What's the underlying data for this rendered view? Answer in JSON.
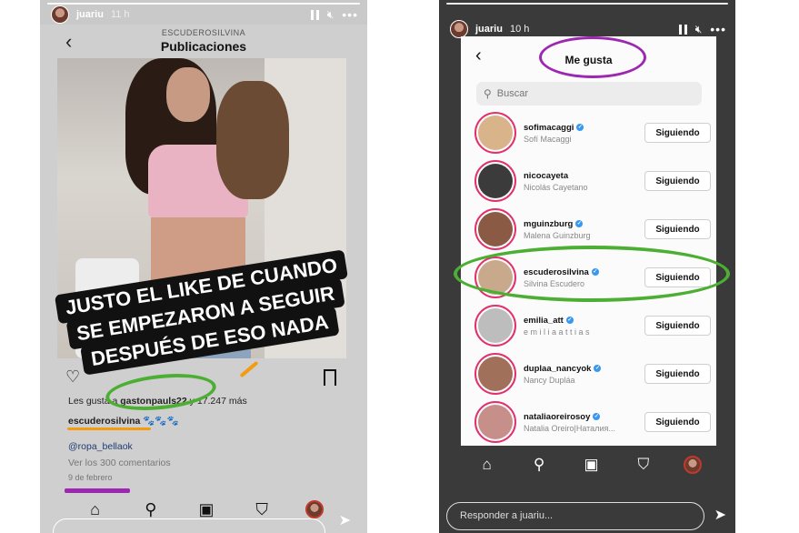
{
  "left_story": {
    "username": "juariu",
    "time": "11 h",
    "post_header_sub": "ESCUDEROSILVINA",
    "post_header_title": "Publicaciones",
    "overlay_lines": [
      "JUSTO EL LIKE DE CUANDO",
      "SE EMPEZARON A SEGUIR",
      "DESPUÉS DE ESO NADA"
    ],
    "likes_prefix": "Les gusta a",
    "likes_user": "gastonpauls22",
    "likes_suffix": "y 17.247 más",
    "caption_user": "escuderosilvina",
    "caption_text": "🐾🐾🐾",
    "mention": "@ropa_bellaok",
    "comments": "Ver los 300 comentarios",
    "date": "9 de febrero"
  },
  "right_story": {
    "username": "juariu",
    "time": "10 h",
    "title": "Me gusta",
    "search_placeholder": "Buscar",
    "users": [
      {
        "handle": "sofimacaggi",
        "name": "Sofí Macaggi",
        "verified": true,
        "button": "Siguiendo",
        "avatar_color": "#d9b48a"
      },
      {
        "handle": "nicocayeta",
        "name": "Nicolás Cayetano",
        "verified": false,
        "button": "Siguiendo",
        "avatar_color": "#3b3b3b"
      },
      {
        "handle": "mguinzburg",
        "name": "Malena Guinzburg",
        "verified": true,
        "button": "Siguiendo",
        "avatar_color": "#8a5a44"
      },
      {
        "handle": "escuderosilvina",
        "name": "Silvina Escudero",
        "verified": true,
        "button": "Siguiendo",
        "avatar_color": "#c9a98c"
      },
      {
        "handle": "emilia_att",
        "name": "e m i l i a   a t t i a s",
        "verified": true,
        "button": "Siguiendo",
        "avatar_color": "#bdbdbd"
      },
      {
        "handle": "duplaa_nancyok",
        "name": "Nancy Dupláa",
        "verified": true,
        "button": "Siguiendo",
        "avatar_color": "#a0705a"
      },
      {
        "handle": "nataliaoreirosoy",
        "name": "Natalia Oreiro|Наталия...",
        "verified": true,
        "button": "Siguiendo",
        "avatar_color": "#c78f8a"
      }
    ],
    "reply_placeholder": "Responder a juariu..."
  },
  "colors": {
    "annotation_purple": "#9c27b0",
    "annotation_green": "#4caf33",
    "annotation_orange": "#f39c12",
    "verified_blue": "#3897f0"
  }
}
